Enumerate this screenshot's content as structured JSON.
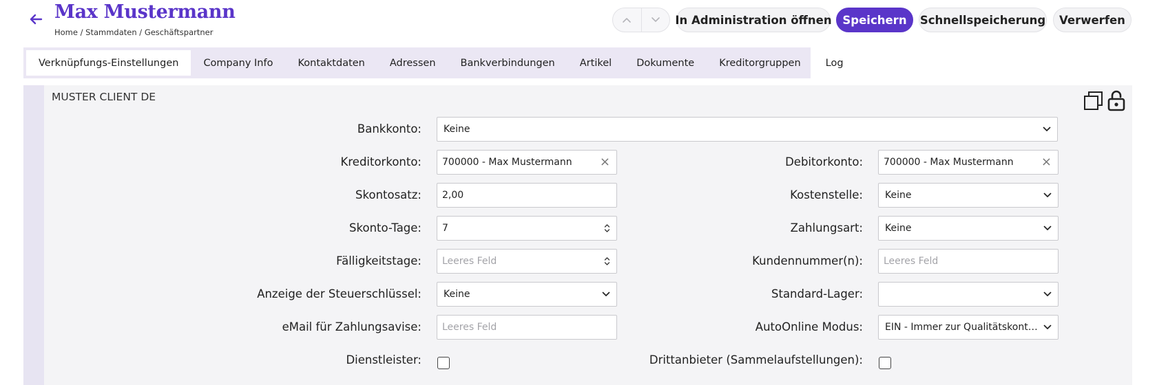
{
  "header": {
    "title": "Max Mustermann",
    "breadcrumb": "Home / Stammdaten / Geschäftspartner",
    "buttons": {
      "open_admin": "In Administration öffnen",
      "save": "Speichern",
      "quick_save": "Schnellspeicherung",
      "discard": "Verwerfen"
    },
    "accent_color": "#5a35c9"
  },
  "tabs": [
    "Verknüpfungs-Einstellungen",
    "Company Info",
    "Kontaktdaten",
    "Adressen",
    "Bankverbindungen",
    "Artikel",
    "Dokumente",
    "Kreditorgruppen",
    "Log"
  ],
  "active_tab": "Verknüpfungs-Einstellungen",
  "section": {
    "title": "MUSTER CLIENT DE",
    "icons": [
      "copy-icon",
      "lock-icon"
    ]
  },
  "form": {
    "bankkonto": {
      "label": "Bankkonto:",
      "value": "Keine"
    },
    "kreditorkonto": {
      "label": "Kreditorkonto:",
      "value": "700000 - Max Mustermann"
    },
    "debitorkonto": {
      "label": "Debitorkonto:",
      "value": "700000 - Max Mustermann"
    },
    "skontosatz": {
      "label": "Skontosatz:",
      "value": "2,00"
    },
    "kostenstelle": {
      "label": "Kostenstelle:",
      "value": "Keine"
    },
    "skonto_tage": {
      "label": "Skonto-Tage:",
      "value": "7"
    },
    "zahlungsart": {
      "label": "Zahlungsart:",
      "value": "Keine"
    },
    "faelligkeitstage": {
      "label": "Fälligkeitstage:",
      "placeholder": "Leeres Feld"
    },
    "kundennummer": {
      "label": "Kundennummer(n):",
      "placeholder": "Leeres Feld"
    },
    "steuerschluessel": {
      "label": "Anzeige der Steuerschlüssel:",
      "value": "Keine"
    },
    "standard_lager": {
      "label": "Standard-Lager:",
      "value": ""
    },
    "email_avise": {
      "label": "eMail für Zahlungsavise:",
      "placeholder": "Leeres Feld"
    },
    "autoonline": {
      "label": "AutoOnline Modus:",
      "value": "EIN - Immer zur Qualitätskontroll..."
    },
    "dienstleister": {
      "label": "Dienstleister:",
      "checked": false
    },
    "drittanbieter": {
      "label": "Drittanbieter (Sammelaufstellungen):",
      "checked": false
    }
  }
}
